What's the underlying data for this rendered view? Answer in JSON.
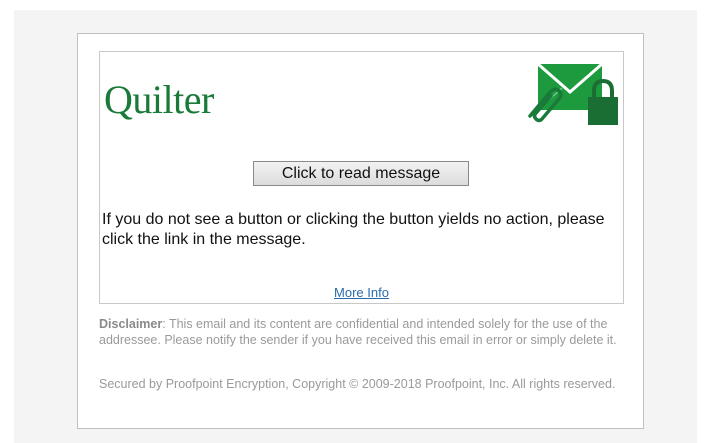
{
  "brand": {
    "logo_text": "Quilter",
    "logo_color": "#1a7a3a",
    "accent_icon": "envelope-lock-paperclip-icon"
  },
  "message": {
    "read_button_label": "Click to read message",
    "instructions": "If you do not see a button or clicking the button yields no action, please click the link in the message.",
    "more_info_link": "More Info"
  },
  "footer": {
    "disclaimer_label": "Disclaimer",
    "disclaimer_text": ": This email and its content are confidential and intended solely for the use of the addressee. Please notify the sender if you have received this email in error or simply delete it.",
    "copyright": "Secured by Proofpoint Encryption, Copyright © 2009-2018 Proofpoint, Inc. All rights reserved."
  }
}
